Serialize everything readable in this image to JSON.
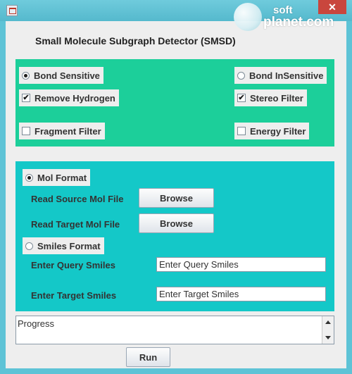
{
  "window": {
    "close_glyph": "✕",
    "watermark": {
      "line1": "soft",
      "line2": "planet.com"
    }
  },
  "header": {
    "title": "Small Molecule Subgraph Detector (SMSD)"
  },
  "options": {
    "bond_sensitive": {
      "label": "Bond Sensitive",
      "selected": true
    },
    "bond_insensitive": {
      "label": "Bond InSensitive",
      "selected": false
    },
    "remove_hydrogen": {
      "label": "Remove Hydrogen",
      "checked": true
    },
    "stereo_filter": {
      "label": "Stereo Filter",
      "checked": true
    },
    "fragment_filter": {
      "label": "Fragment Filter",
      "checked": false
    },
    "energy_filter": {
      "label": "Energy Filter",
      "checked": false
    }
  },
  "input": {
    "mol_format": {
      "label": "Mol Format",
      "selected": true
    },
    "read_source_label": "Read Source Mol File",
    "read_target_label": "Read Target Mol File",
    "browse_label": "Browse",
    "smiles_format": {
      "label": "Smiles Format",
      "selected": false
    },
    "query_smiles_label": "Enter Query Smiles",
    "query_smiles_value": "Enter Query Smiles",
    "target_smiles_label": "Enter Target Smiles",
    "target_smiles_value": "Enter Target Smiles"
  },
  "progress": {
    "text": "Progress"
  },
  "footer": {
    "run_label": "Run"
  },
  "colors": {
    "window_frame": "#5ec3d6",
    "options_panel": "#1ccf9a",
    "input_panel": "#14c8c8",
    "close_button": "#c9463d"
  }
}
